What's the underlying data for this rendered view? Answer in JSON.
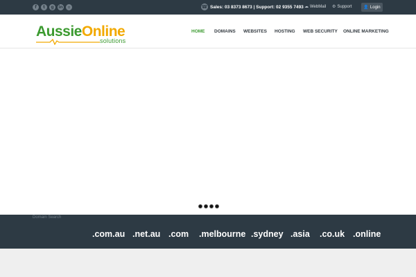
{
  "topbar": {
    "social_icons": [
      "facebook-icon",
      "twitter-icon",
      "google-plus-icon",
      "linkedin-icon",
      "flickr-icon"
    ],
    "contact": "Sales: 03 8373 8673 | Support: 02 9355 7493",
    "webmail": "WebMail",
    "support": "Support",
    "login": "Login"
  },
  "logo": {
    "part1": "Aussie",
    "part2": "Online",
    "sub": "solutions",
    "colors": {
      "green": "#3b9a2f",
      "gold": "#f2a900"
    }
  },
  "nav": {
    "home": "HOME",
    "domains": "DOMAINS",
    "websites": "WEBSITES",
    "hosting": "HOSTING",
    "web_security": "WEB SECURITY",
    "online_marketing": "ONLINE MARKETING",
    "active_color": "#3b9a2f"
  },
  "slider": {
    "dot_count": 4
  },
  "domain_search": {
    "label": "Domain Search",
    "tlds": [
      ".com.au",
      ".net.au",
      ".com",
      ".melbourne",
      ".sydney",
      ".asia",
      ".co.uk",
      ".online"
    ]
  },
  "theme": {
    "dark_bar": "#2d3a44",
    "bottom_bg": "#efefef"
  }
}
